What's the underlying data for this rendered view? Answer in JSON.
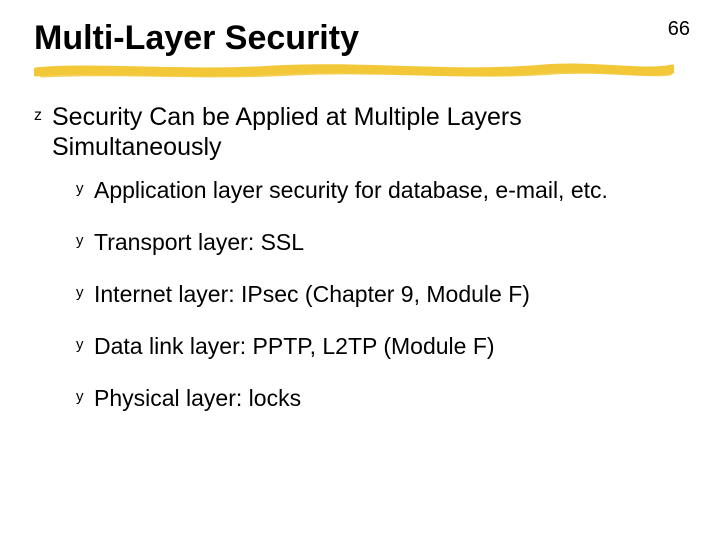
{
  "page_number": "66",
  "title": "Multi-Layer Security",
  "accent_color": "#f2c838",
  "bullets": {
    "lvl1_glyph": "z",
    "lvl2_glyph": "y",
    "lvl1": [
      {
        "text": "Security Can be Applied at Multiple Layers Simultaneously"
      }
    ],
    "lvl2": [
      {
        "text": "Application layer security for database, e-mail, etc."
      },
      {
        "text": "Transport layer: SSL"
      },
      {
        "text": "Internet layer: IPsec (Chapter 9, Module F)"
      },
      {
        "text": "Data link layer: PPTP, L2TP (Module F)"
      },
      {
        "text": "Physical layer: locks"
      }
    ]
  }
}
